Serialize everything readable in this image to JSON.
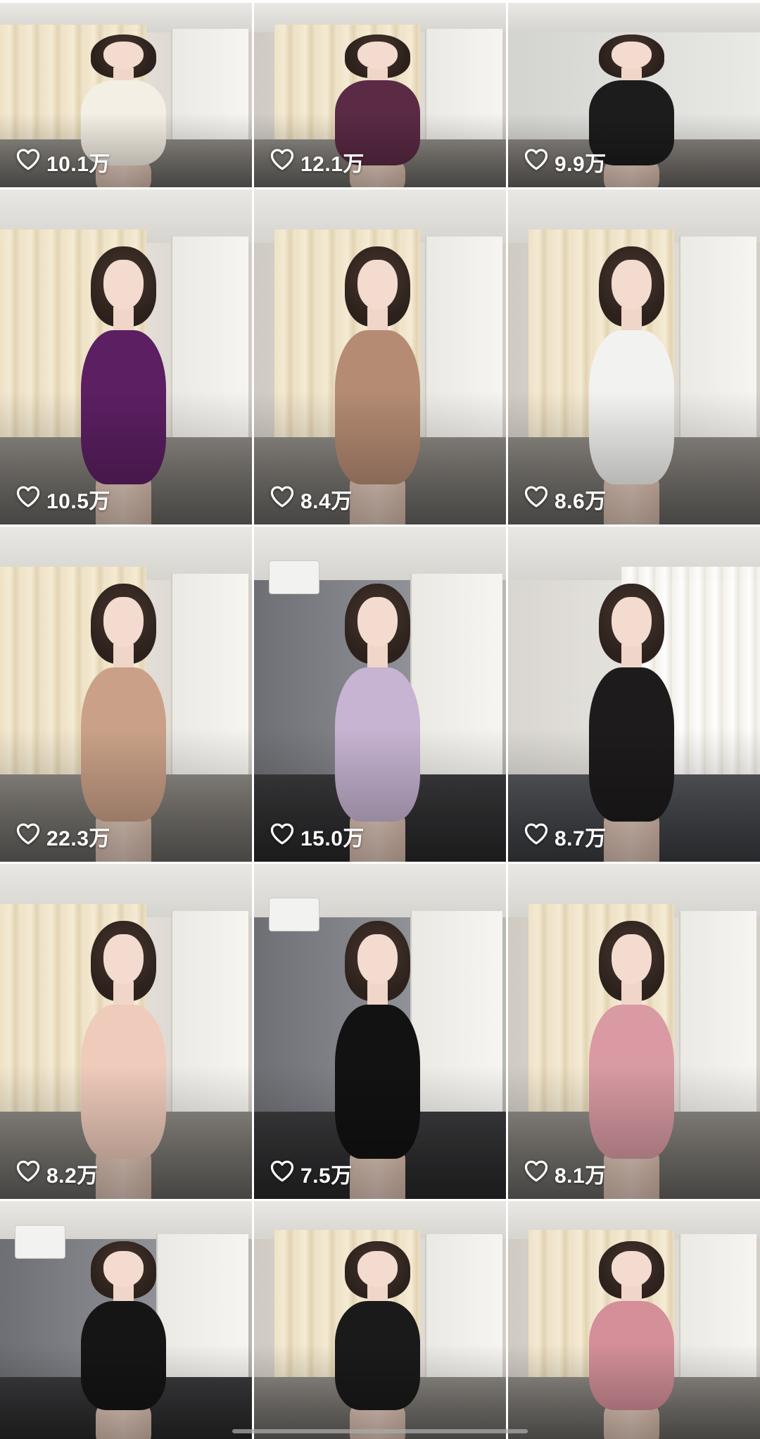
{
  "feed": {
    "tiles": [
      {
        "likes": "10.1万",
        "outfit_color": "#f4efe4",
        "scene": "bed"
      },
      {
        "likes": "12.1万",
        "outfit_color": "#5b2a45",
        "scene": "curtain"
      },
      {
        "likes": "9.9万",
        "outfit_color": "#1c1c1c",
        "scene": "room"
      },
      {
        "likes": "10.5万",
        "outfit_color": "#5c1f62",
        "scene": "curtain"
      },
      {
        "likes": "8.4万",
        "outfit_color": "#b58b73",
        "scene": "curtain"
      },
      {
        "likes": "8.6万",
        "outfit_color": "#f2f2f0",
        "scene": "curtain"
      },
      {
        "likes": "22.3万",
        "outfit_color": "#caa188",
        "scene": "curtain"
      },
      {
        "likes": "15.0万",
        "outfit_color": "#c6b4d2",
        "scene": "dark"
      },
      {
        "likes": "8.7万",
        "outfit_color": "#1d1b1c",
        "scene": "bright"
      },
      {
        "likes": "8.2万",
        "outfit_color": "#efcbbb",
        "scene": "curtain"
      },
      {
        "likes": "7.5万",
        "outfit_color": "#121212",
        "scene": "dark"
      },
      {
        "likes": "8.1万",
        "outfit_color": "#d99aa3",
        "scene": "curtain"
      },
      {
        "likes": "",
        "outfit_color": "#151515",
        "scene": "dark"
      },
      {
        "likes": "",
        "outfit_color": "#1a1a1a",
        "scene": "curtain"
      },
      {
        "likes": "",
        "outfit_color": "#d48f99",
        "scene": "curtain"
      }
    ],
    "icon": "heart-outline-icon"
  }
}
